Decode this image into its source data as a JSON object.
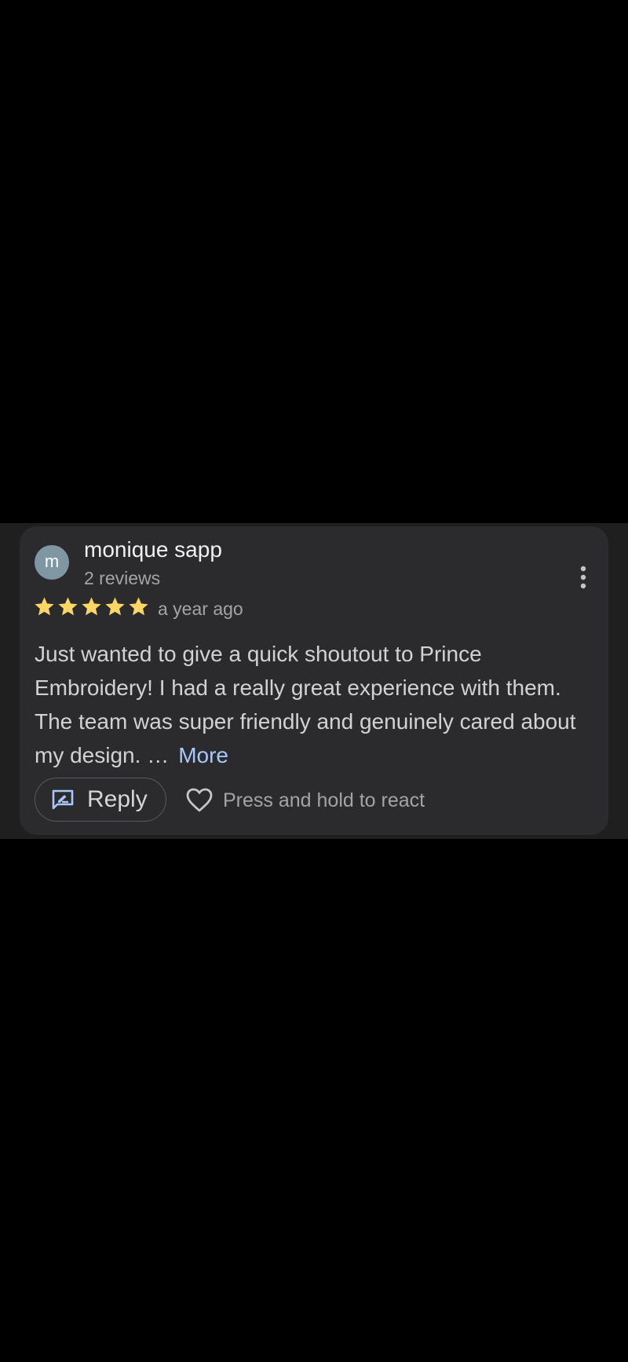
{
  "review": {
    "avatar_initial": "m",
    "reviewer_name": "monique sapp",
    "reviewer_meta": "2 reviews",
    "rating": 5,
    "rating_max": 5,
    "time": "a year ago",
    "text": "Just wanted to give a quick shoutout to Prince Embroidery! I had a really great experience with them. The team was super friendly and genuinely cared about my design.",
    "ellipsis": "…",
    "more_label": "More"
  },
  "actions": {
    "reply_label": "Reply",
    "react_hint": "Press and hold to react"
  },
  "icons": {
    "menu": "more-vertical-icon",
    "stars": "star-icon",
    "reply": "reply-edit-icon",
    "react": "heart-icon"
  },
  "colors": {
    "page_background": "#000000",
    "band_background": "#1f1f1f",
    "card_background": "#2b2b2d",
    "avatar": "#7f96a3",
    "star": "#fdd663",
    "link": "#a8c7fa",
    "primary_text": "#f1f1f1",
    "secondary_text": "#a4a4a4"
  }
}
